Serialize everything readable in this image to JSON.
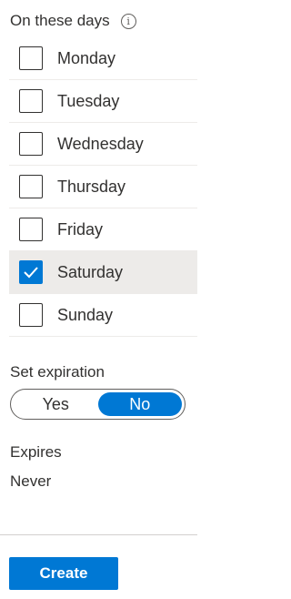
{
  "days_section": {
    "title": "On these days",
    "info_icon": "info-icon",
    "days": [
      {
        "label": "Monday",
        "checked": false
      },
      {
        "label": "Tuesday",
        "checked": false
      },
      {
        "label": "Wednesday",
        "checked": false
      },
      {
        "label": "Thursday",
        "checked": false
      },
      {
        "label": "Friday",
        "checked": false
      },
      {
        "label": "Saturday",
        "checked": true
      },
      {
        "label": "Sunday",
        "checked": false
      }
    ]
  },
  "expiration": {
    "label": "Set expiration",
    "yes_label": "Yes",
    "no_label": "No",
    "selected": "No"
  },
  "expires": {
    "label": "Expires",
    "value": "Never"
  },
  "create_button": {
    "label": "Create"
  },
  "colors": {
    "accent": "#0078d4",
    "selected_row": "#edebe9",
    "text": "#323130"
  }
}
